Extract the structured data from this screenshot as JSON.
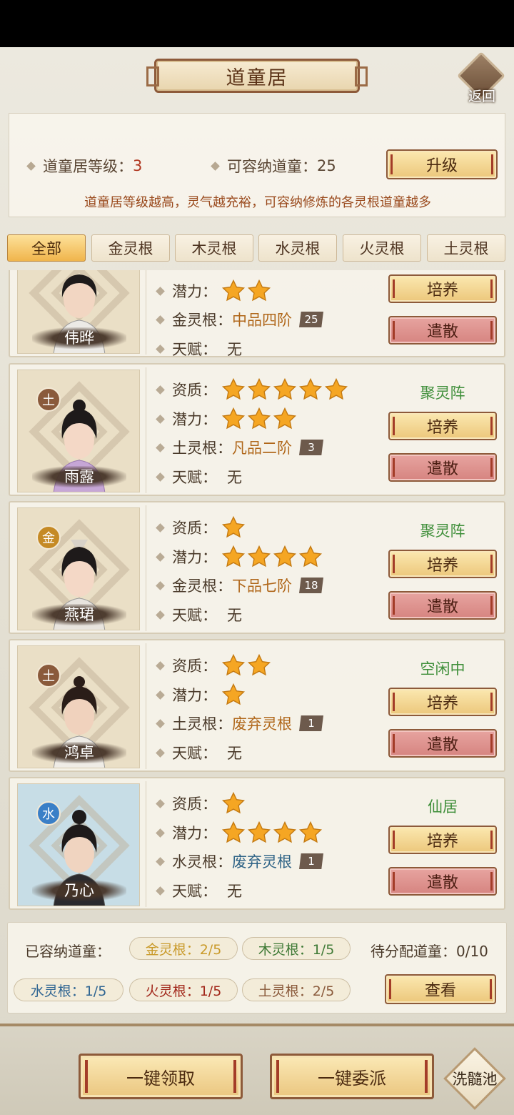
{
  "header": {
    "title": "道童居",
    "back_label": "返回"
  },
  "info": {
    "level_label": "道童居等级：",
    "level_value": "3",
    "capacity_label": "可容纳道童：",
    "capacity_value": "25",
    "upgrade_label": "升级",
    "description": "道童居等级越高，灵气越充裕，可容纳修炼的各灵根道童越多"
  },
  "tabs": [
    "全部",
    "金灵根",
    "木灵根",
    "水灵根",
    "火灵根",
    "土灵根"
  ],
  "labels": {
    "aptitude": "资质：",
    "potential": "潜力：",
    "talent": "天赋：",
    "train": "培养",
    "dismiss": "遣散"
  },
  "disciples": [
    {
      "name": "伟晔",
      "element": "",
      "aptitude_stars": null,
      "potential_stars": 2,
      "root_label": "金灵根：",
      "root_grade": "中品四阶",
      "root_level": "25",
      "talent": "无",
      "status": ""
    },
    {
      "name": "雨露",
      "element": "土",
      "aptitude_stars": 5,
      "potential_stars": 3,
      "root_label": "土灵根：",
      "root_grade": "凡品二阶",
      "root_level": "3",
      "talent": "无",
      "status": "聚灵阵"
    },
    {
      "name": "燕珺",
      "element": "金",
      "aptitude_stars": 1,
      "potential_stars": 4,
      "root_label": "金灵根：",
      "root_grade": "下品七阶",
      "root_level": "18",
      "talent": "无",
      "status": "聚灵阵"
    },
    {
      "name": "鸿卓",
      "element": "土",
      "aptitude_stars": 2,
      "potential_stars": 1,
      "root_label": "土灵根：",
      "root_grade": "废弃灵根",
      "root_level": "1",
      "talent": "无",
      "status": "空闲中"
    },
    {
      "name": "乃心",
      "element": "水",
      "aptitude_stars": 1,
      "potential_stars": 4,
      "root_label": "水灵根：",
      "root_grade": "废弃灵根",
      "root_level": "1",
      "talent": "无",
      "status": "仙居"
    }
  ],
  "summary": {
    "housed_label": "已容纳道童：",
    "jin": "金灵根：2/5",
    "mu": "木灵根：1/5",
    "shui": "水灵根：1/5",
    "huo": "火灵根：1/5",
    "tu": "土灵根：2/5",
    "pending": "待分配道童：0/10",
    "view_label": "查看"
  },
  "footer": {
    "collect_all": "一键领取",
    "assign_all": "一键委派",
    "wash_pool": "洗髓池"
  },
  "colors": {
    "gold_button": "#ecc77b",
    "red_button": "#d68480",
    "active_tab": "#f0b54c",
    "status_green": "#3f8f3a",
    "star": "#f5a623"
  }
}
